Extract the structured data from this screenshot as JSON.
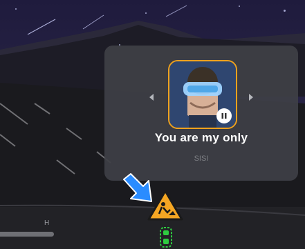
{
  "media": {
    "song_title": "You are my only",
    "artist": "SISI",
    "album_art": "movie-poster-vr-headset-icon",
    "play_state": "playing"
  },
  "status": {
    "gauge_label": "H"
  },
  "icons": {
    "prev": "chevron-left-icon",
    "next": "chevron-right-icon",
    "pause": "pause-icon",
    "pointer": "blue-arrow-icon",
    "warning": "road-work-warning-icon",
    "vehicle": "car-icon"
  },
  "colors": {
    "accent": "#f0a21c",
    "pointer": "#2a8cff",
    "vehicle": "#2ecc40"
  }
}
